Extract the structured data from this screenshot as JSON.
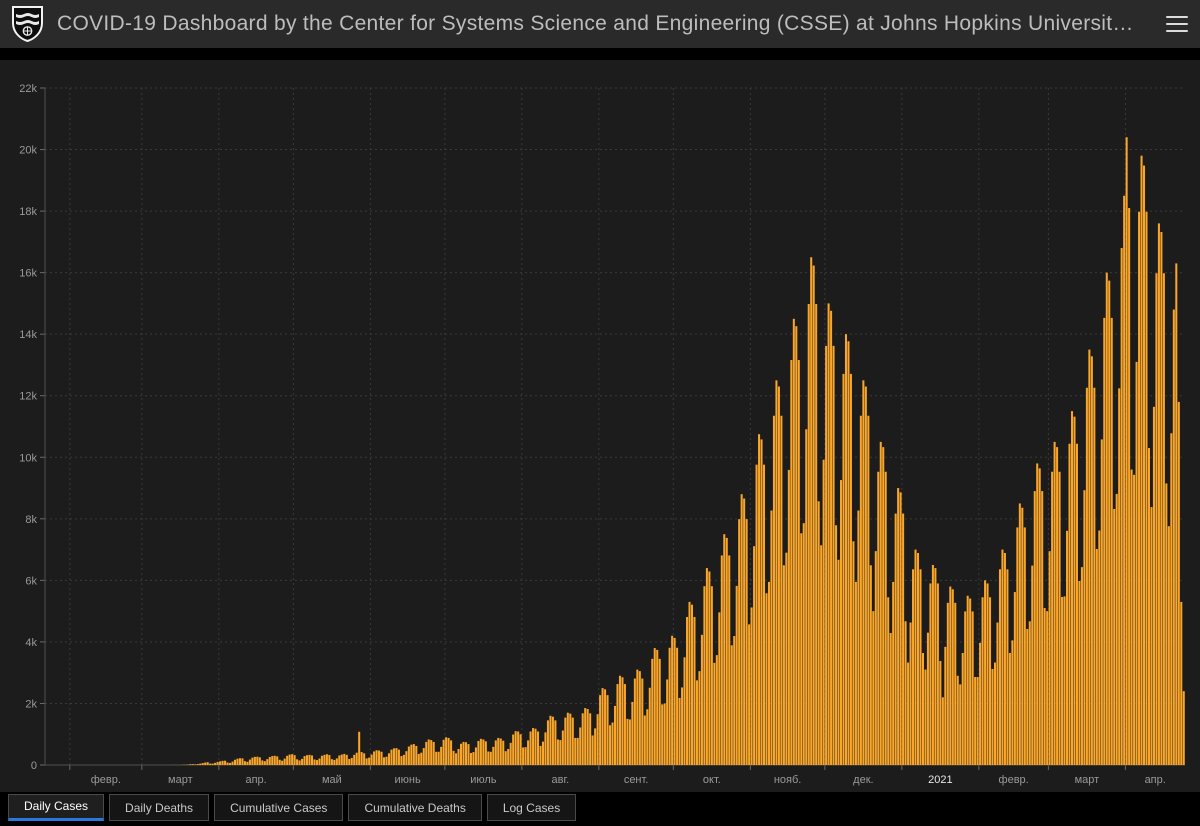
{
  "header": {
    "title": "COVID-19 Dashboard by the Center for Systems Science and Engineering (CSSE) at Johns Hopkins Universit…",
    "logo": "johns-hopkins-shield",
    "menu_icon": "hamburger-icon"
  },
  "tabs": {
    "active": "Daily Cases",
    "items": [
      {
        "label": "Daily Cases"
      },
      {
        "label": "Daily Deaths"
      },
      {
        "label": "Cumulative Cases"
      },
      {
        "label": "Cumulative Deaths"
      },
      {
        "label": "Log Cases"
      }
    ]
  },
  "colors": {
    "header_bg": "#2a2a2a",
    "panel_bg": "#1c1c1c",
    "bar": "#f9a62a",
    "grid": "#3a3a3a",
    "axis": "#4f4f4f",
    "tick": "#6a6a6a",
    "axis_label": "#9a9a9a",
    "year_label": "#e6e6e6",
    "active_tab_underline": "#2878e0"
  },
  "chart_data": {
    "type": "bar",
    "title": "Daily Cases",
    "xlabel": "",
    "ylabel": "",
    "ylim": [
      0,
      22000
    ],
    "grid": true,
    "y_ticks": [
      0,
      2000,
      4000,
      6000,
      8000,
      10000,
      12000,
      14000,
      16000,
      18000,
      20000,
      22000
    ],
    "y_tick_labels": [
      "0",
      "2k",
      "4k",
      "6k",
      "8k",
      "10k",
      "12k",
      "14k",
      "16k",
      "18k",
      "20k",
      "22k"
    ],
    "x_labels": [
      {
        "text": "февр.",
        "from": 10,
        "to": 39
      },
      {
        "text": "март",
        "from": 39,
        "to": 70
      },
      {
        "text": "апр.",
        "from": 70,
        "to": 100
      },
      {
        "text": "май",
        "from": 100,
        "to": 131
      },
      {
        "text": "июнь",
        "from": 131,
        "to": 161
      },
      {
        "text": "июль",
        "from": 161,
        "to": 192
      },
      {
        "text": "авг.",
        "from": 192,
        "to": 223
      },
      {
        "text": "сент.",
        "from": 223,
        "to": 253
      },
      {
        "text": "окт.",
        "from": 253,
        "to": 284
      },
      {
        "text": "нояб.",
        "from": 284,
        "to": 314
      },
      {
        "text": "дек.",
        "from": 314,
        "to": 345
      },
      {
        "text": "2021",
        "from": 345,
        "to": 376,
        "year": true
      },
      {
        "text": "февр.",
        "from": 376,
        "to": 404
      },
      {
        "text": "март",
        "from": 404,
        "to": 435
      },
      {
        "text": "апр.",
        "from": 435,
        "to": 459
      }
    ],
    "x_tick_indices": [
      10,
      39,
      70,
      100,
      131,
      161,
      192,
      223,
      253,
      284,
      314,
      345,
      376,
      404,
      435
    ],
    "values": [
      0,
      0,
      0,
      0,
      0,
      0,
      0,
      0,
      0,
      0,
      0,
      0,
      0,
      0,
      0,
      0,
      0,
      0,
      0,
      0,
      0,
      0,
      0,
      0,
      0,
      0,
      0,
      0,
      0,
      0,
      0,
      0,
      0,
      0,
      0,
      0,
      0,
      0,
      0,
      0,
      0,
      1,
      0,
      1,
      1,
      0,
      0,
      1,
      1,
      1,
      1,
      3,
      2,
      2,
      3,
      7,
      10,
      14,
      26,
      27,
      21,
      30,
      44,
      62,
      80,
      92,
      46,
      45,
      70,
      100,
      120,
      135,
      140,
      80,
      68,
      110,
      170,
      206,
      220,
      215,
      125,
      105,
      175,
      240,
      265,
      270,
      250,
      150,
      125,
      190,
      260,
      290,
      300,
      280,
      170,
      140,
      210,
      300,
      340,
      350,
      320,
      185,
      150,
      200,
      290,
      320,
      330,
      310,
      180,
      160,
      210,
      300,
      330,
      350,
      325,
      190,
      165,
      215,
      310,
      340,
      360,
      330,
      195,
      230,
      330,
      400,
      1080,
      420,
      380,
      215,
      240,
      340,
      440,
      480,
      470,
      430,
      250,
      270,
      380,
      500,
      540,
      550,
      500,
      290,
      330,
      450,
      600,
      660,
      680,
      620,
      360,
      400,
      550,
      750,
      830,
      810,
      750,
      430,
      430,
      590,
      820,
      900,
      880,
      800,
      460,
      380,
      520,
      690,
      750,
      740,
      680,
      390,
      420,
      570,
      780,
      850,
      830,
      770,
      440,
      430,
      590,
      800,
      880,
      860,
      790,
      450,
      520,
      720,
      990,
      1100,
      1090,
      1000,
      570,
      580,
      800,
      1090,
      1200,
      1180,
      1090,
      620,
      760,
      1060,
      1450,
      1600,
      1570,
      1450,
      830,
      810,
      1120,
      1540,
      1700,
      1670,
      1540,
      880,
      880,
      1220,
      1680,
      1850,
      1820,
      1680,
      960,
      1190,
      1650,
      2270,
      2500,
      2460,
      2270,
      1290,
      1380,
      1920,
      2630,
      2900,
      2850,
      2630,
      1500,
      1480,
      2050,
      2810,
      3100,
      3050,
      2810,
      1610,
      1810,
      2510,
      3450,
      3800,
      3740,
      3450,
      1970,
      2000,
      2780,
      3810,
      4200,
      4130,
      3810,
      2180,
      2520,
      3500,
      4810,
      5300,
      5210,
      4810,
      2750,
      3050,
      4230,
      5810,
      6400,
      6290,
      5810,
      3320,
      3570,
      4960,
      6810,
      7500,
      7380,
      6810,
      3890,
      4190,
      5820,
      7990,
      8800,
      8660,
      7990,
      4570,
      5120,
      7110,
      9760,
      10750,
      10580,
      9760,
      5580,
      5950,
      8270,
      11350,
      12500,
      12300,
      11350,
      6490,
      6900,
      9590,
      13160,
      14500,
      14260,
      13160,
      7530,
      7860,
      10910,
      14980,
      16500,
      16230,
      14980,
      8570,
      7140,
      9920,
      13620,
      15000,
      14760,
      13620,
      7790,
      6670,
      9260,
      12710,
      14000,
      13770,
      12710,
      7270,
      5950,
      8270,
      11350,
      12500,
      12300,
      11350,
      6490,
      5000,
      6950,
      9530,
      10500,
      10330,
      9530,
      5450,
      4290,
      5950,
      8170,
      9000,
      8860,
      8170,
      4670,
      3330,
      4630,
      6360,
      7000,
      6890,
      6360,
      3640,
      3100,
      4300,
      5900,
      6500,
      6400,
      5900,
      3380,
      2200,
      3840,
      5270,
      5800,
      5710,
      5270,
      2900,
      2620,
      3640,
      4990,
      5500,
      5410,
      4990,
      2860,
      2860,
      3970,
      5450,
      6000,
      5900,
      5450,
      3120,
      3330,
      4630,
      6360,
      7000,
      6890,
      6360,
      3640,
      4050,
      5620,
      7720,
      8500,
      8360,
      7720,
      4420,
      4670,
      6480,
      8900,
      9800,
      9640,
      8900,
      5100,
      5000,
      6950,
      9530,
      10500,
      10330,
      9530,
      5460,
      5480,
      7610,
      10440,
      11500,
      11320,
      10440,
      5980,
      6430,
      8930,
      12260,
      13500,
      13280,
      12260,
      7020,
      7620,
      10580,
      14530,
      16000,
      15740,
      14530,
      8320,
      8810,
      12240,
      16800,
      18500,
      20400,
      18100,
      9600,
      9430,
      13100,
      17980,
      19800,
      19480,
      17980,
      10300,
      8380,
      11640,
      15980,
      17600,
      17320,
      15980,
      9150,
      7760,
      10780,
      14800,
      16300,
      11800,
      5300,
      2400
    ]
  }
}
